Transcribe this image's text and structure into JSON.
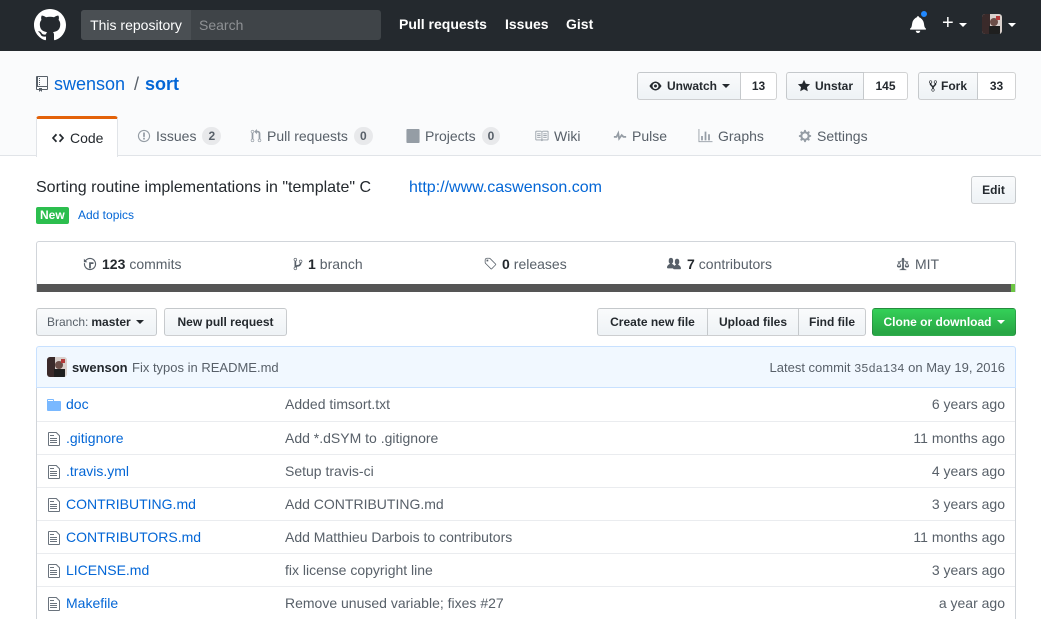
{
  "header": {
    "scope_label": "This repository",
    "search_placeholder": "Search",
    "nav": [
      "Pull requests",
      "Issues",
      "Gist"
    ]
  },
  "repo": {
    "owner": "swenson",
    "separator": "/",
    "name": "sort",
    "watch": {
      "label": "Unwatch",
      "count": "13"
    },
    "star": {
      "label": "Unstar",
      "count": "145"
    },
    "fork": {
      "label": "Fork",
      "count": "33"
    }
  },
  "tabs": [
    {
      "label": "Code",
      "icon": "code-icon"
    },
    {
      "label": "Issues",
      "count": "2",
      "icon": "issue-icon"
    },
    {
      "label": "Pull requests",
      "count": "0",
      "icon": "pull-request-icon"
    },
    {
      "label": "Projects",
      "count": "0",
      "icon": "project-icon"
    },
    {
      "label": "Wiki",
      "icon": "book-icon"
    },
    {
      "label": "Pulse",
      "icon": "pulse-icon"
    },
    {
      "label": "Graphs",
      "icon": "graph-icon"
    },
    {
      "label": "Settings",
      "icon": "gear-icon"
    }
  ],
  "description": {
    "text": "Sorting routine implementations in \"template\" C",
    "homepage": "http://www.caswenson.com",
    "edit_label": "Edit",
    "new_label": "New",
    "add_topics": "Add topics"
  },
  "summary": {
    "commits": {
      "count": "123",
      "label": "commits"
    },
    "branches": {
      "count": "1",
      "label": "branch"
    },
    "releases": {
      "count": "0",
      "label": "releases"
    },
    "contributors": {
      "count": "7",
      "label": "contributors"
    },
    "license": "MIT"
  },
  "file_nav": {
    "branch_prefix": "Branch:",
    "branch_name": "master",
    "new_pr": "New pull request",
    "create_file": "Create new file",
    "upload_files": "Upload files",
    "find_file": "Find file",
    "clone": "Clone or download"
  },
  "latest_commit": {
    "author": "swenson",
    "message": "Fix typos in README.md",
    "prefix": "Latest commit",
    "sha": "35da134",
    "date_prefix": "on",
    "date": "May 19, 2016"
  },
  "files": [
    {
      "name": "doc",
      "type": "directory",
      "message": "Added timsort.txt",
      "age": "6 years ago"
    },
    {
      "name": ".gitignore",
      "type": "file",
      "message": "Add *.dSYM to .gitignore",
      "age": "11 months ago"
    },
    {
      "name": ".travis.yml",
      "type": "file",
      "message": "Setup travis-ci",
      "age": "4 years ago"
    },
    {
      "name": "CONTRIBUTING.md",
      "type": "file",
      "message": "Add CONTRIBUTING.md",
      "age": "3 years ago"
    },
    {
      "name": "CONTRIBUTORS.md",
      "type": "file",
      "message": "Add Matthieu Darbois to contributors",
      "age": "11 months ago"
    },
    {
      "name": "LICENSE.md",
      "type": "file",
      "message": "fix license copyright line",
      "age": "3 years ago"
    },
    {
      "name": "Makefile",
      "type": "file",
      "message": "Remove unused variable; fixes #27",
      "age": "a year ago"
    }
  ],
  "colors": {
    "header_bg": "#24292e",
    "link": "#0366d6",
    "selected_tab_accent": "#e36209",
    "clone_button": "#28a745",
    "new_label": "#2cbe4e",
    "language_bar": "#555555"
  }
}
